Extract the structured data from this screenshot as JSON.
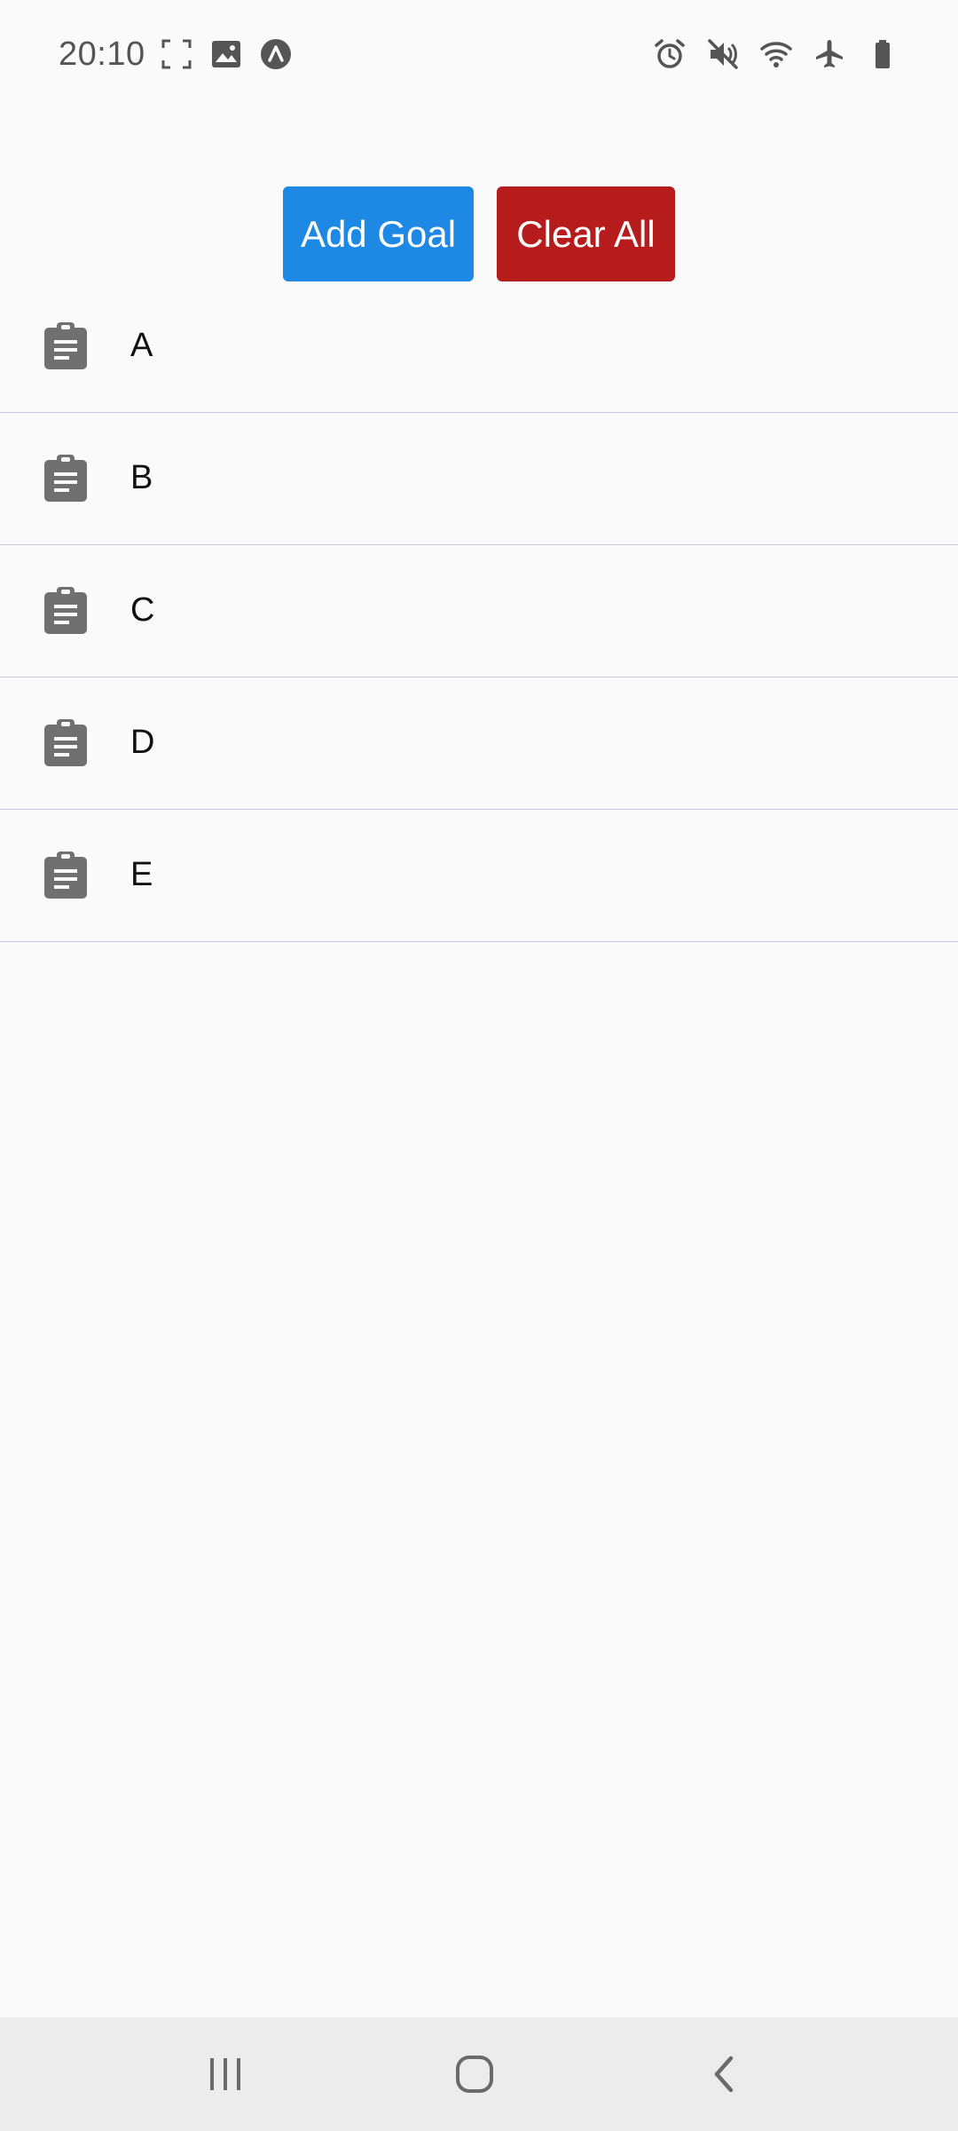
{
  "status_bar": {
    "time": "20:10",
    "left_icons": [
      "screenshot-frame-icon",
      "gallery-icon",
      "app-logo-icon"
    ],
    "right_icons": [
      "alarm-icon",
      "mute-icon",
      "wifi-icon",
      "airplane-icon",
      "battery-icon"
    ]
  },
  "toolbar": {
    "add_label": "Add Goal",
    "clear_label": "Clear All",
    "add_color": "#1e88e5",
    "clear_color": "#b71c1c"
  },
  "goals": [
    {
      "label": "A",
      "icon": "clipboard-icon"
    },
    {
      "label": "B",
      "icon": "clipboard-icon"
    },
    {
      "label": "C",
      "icon": "clipboard-icon"
    },
    {
      "label": "D",
      "icon": "clipboard-icon"
    },
    {
      "label": "E",
      "icon": "clipboard-icon"
    }
  ],
  "nav_bar": {
    "buttons": [
      "recents-icon",
      "home-icon",
      "back-icon"
    ]
  }
}
